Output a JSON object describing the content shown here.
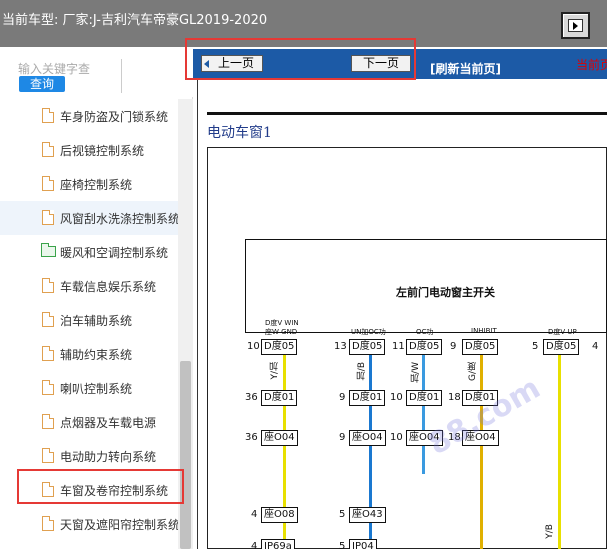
{
  "header": {
    "title": "当前车型: 厂家:J-吉利汽车帝豪GL2019-2020"
  },
  "sidebar": {
    "search_placeholder": "输入关键字查",
    "query_label": "查询",
    "items": [
      {
        "label": "车身防盗及门锁系统",
        "icon": "document-icon"
      },
      {
        "label": "后视镜控制系统",
        "icon": "document-icon"
      },
      {
        "label": "座椅控制系统",
        "icon": "document-icon"
      },
      {
        "label": "风窗刮水洗涤控制系统",
        "icon": "document-icon"
      },
      {
        "label": "暖风和空调控制系统",
        "icon": "folder-icon"
      },
      {
        "label": "车载信息娱乐系统",
        "icon": "document-icon"
      },
      {
        "label": "泊车辅助系统",
        "icon": "document-icon"
      },
      {
        "label": "辅助约束系统",
        "icon": "document-icon"
      },
      {
        "label": "喇叭控制系统",
        "icon": "document-icon"
      },
      {
        "label": "点烟器及车载电源",
        "icon": "document-icon"
      },
      {
        "label": "电动助力转向系统",
        "icon": "document-icon"
      },
      {
        "label": "车窗及卷帘控制系统",
        "icon": "document-icon"
      },
      {
        "label": "天窗及遮阳帘控制系统",
        "icon": "document-icon"
      }
    ]
  },
  "toolbar": {
    "prev_label": "上一页",
    "next_label": "下一页",
    "refresh_label": "[刷新当前页]",
    "current_label": "当前页"
  },
  "diagram": {
    "title": "电动车窗1",
    "module_label": "左前门电动窗主开关",
    "pin_labels": [
      "D度V WIN",
      "座W GND",
      "UN加OC功",
      "OC功",
      "INHIBIT",
      "D度V UP"
    ],
    "row1": [
      {
        "pin": "10",
        "conn": "D度05"
      },
      {
        "pin": "13",
        "conn": "D度05"
      },
      {
        "pin": "11",
        "conn": "D度05"
      },
      {
        "pin": "9",
        "conn": "D度05"
      },
      {
        "pin": "5",
        "conn": "D度05"
      },
      {
        "pin": "4",
        "conn": ""
      }
    ],
    "row2": [
      {
        "pin": "36",
        "conn": "D度01"
      },
      {
        "pin": "9",
        "conn": "D度01"
      },
      {
        "pin": "10",
        "conn": "D度01"
      },
      {
        "pin": "18",
        "conn": "D度01"
      }
    ],
    "row3": [
      {
        "pin": "36",
        "conn": "座O04"
      },
      {
        "pin": "9",
        "conn": "座O04"
      },
      {
        "pin": "10",
        "conn": "座O04"
      },
      {
        "pin": "18",
        "conn": "座O04"
      }
    ],
    "row4": [
      {
        "pin": "4",
        "conn": "座O08"
      },
      {
        "pin": "5",
        "conn": "座O43"
      }
    ],
    "row5": [
      {
        "pin": "4",
        "conn": "IP69a"
      },
      {
        "pin": "5",
        "conn": "IP04"
      }
    ],
    "wire_colors": [
      "Y/加",
      "加/B",
      "加/W",
      "G/度",
      "Y/B"
    ],
    "watermark": "88.com"
  },
  "colors": {
    "topbar": "#7a7a7a",
    "toolbar": "#1c5aa6",
    "accent": "#1e88e5",
    "highlight": "#e53935"
  }
}
